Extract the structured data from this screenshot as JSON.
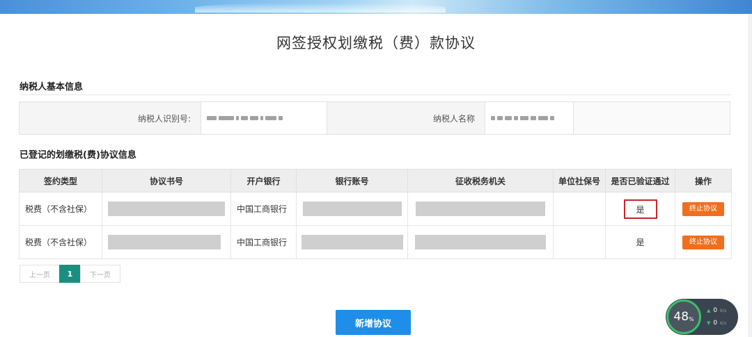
{
  "page": {
    "title": "网签授权划缴税（费）款协议"
  },
  "taxpayer_section": {
    "title": "纳税人基本信息",
    "id_label": "纳税人识别号:",
    "name_label": "纳税人名称"
  },
  "agreement_section": {
    "title": "已登记的划缴税(费)协议信息",
    "columns": [
      "签约类型",
      "协议书号",
      "开户银行",
      "银行账号",
      "征收税务机关",
      "单位社保号",
      "是否已验证通过",
      "操作"
    ],
    "rows": [
      {
        "type": "税费（不含社保）",
        "bank": "中国工商银行",
        "verified": "是",
        "action": "终止协议"
      },
      {
        "type": "税费（不含社保）",
        "bank": "中国工商银行",
        "verified": "是",
        "action": "终止协议"
      }
    ]
  },
  "pager": {
    "prev": "上一页",
    "current": "1",
    "next": "下一页"
  },
  "add_button": "新增协议",
  "speed_widget": {
    "percent": "48",
    "percent_unit": "%",
    "up": "0",
    "down": "0",
    "unit": "K/s"
  },
  "colors": {
    "primary_button": "#1e8ee8",
    "terminate_button": "#f06f1c",
    "pager_active": "#1a8f80",
    "highlight_border": "#c8262a"
  }
}
